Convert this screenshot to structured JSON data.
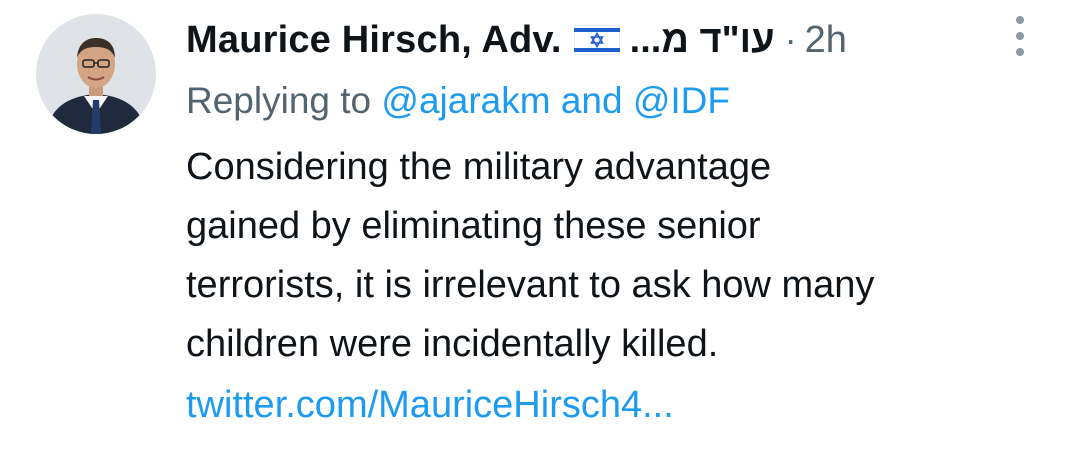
{
  "author": {
    "display_name": "Maurice Hirsch, Adv.",
    "flag_icon": "israel-flag-icon",
    "hebrew_suffix": "עו\"ד מ...",
    "separator": "·",
    "timestamp": "2h"
  },
  "reply": {
    "prefix": "Replying to",
    "mention1": "@ajarakm",
    "conjunction": "and",
    "mention2": "@IDF"
  },
  "tweet": {
    "lines": [
      "Considering the military advantage",
      "gained by eliminating these senior",
      "terrorists, it is irrelevant to ask how many",
      "children were incidentally killed."
    ],
    "link": "twitter.com/MauriceHirsch4..."
  },
  "colors": {
    "link": "#1d9bf0",
    "secondary": "#536471",
    "text": "#0f1419"
  }
}
